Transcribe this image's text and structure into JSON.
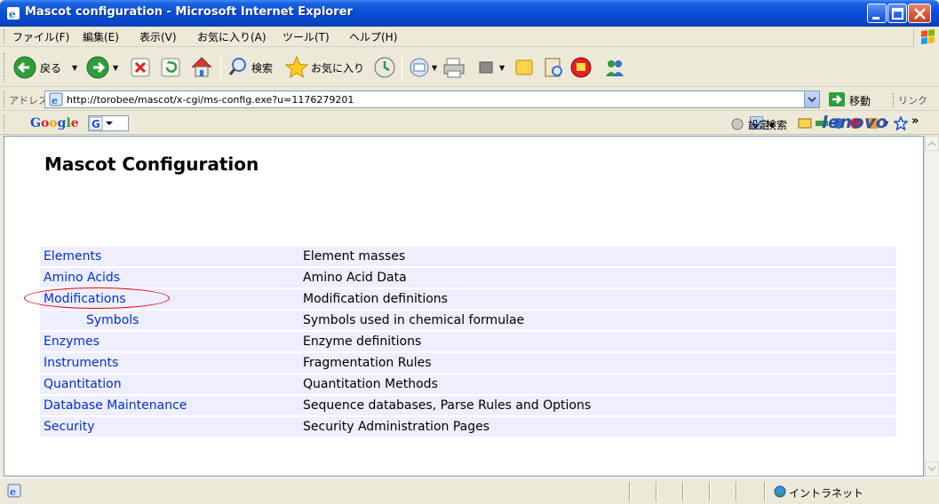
{
  "window": {
    "title": "Mascot configuration - Microsoft Internet Explorer"
  },
  "menu": {
    "items": [
      "ファイル(F)",
      "編集(E)",
      "表示(V)",
      "お気に入り(A)",
      "ツール(T)",
      "ヘルプ(H)"
    ]
  },
  "toolbar": {
    "back_label": "戻る",
    "search_label": "検索",
    "favorites_label": "お気に入り"
  },
  "address_bar": {
    "label": "アドレス(D)",
    "url": "http://torobee/mascot/x-cgi/ms-config.exe?u=1176279201",
    "go_label": "移動",
    "links_label": "リンク"
  },
  "google_bar": {
    "logo": "Google",
    "search_label": "検索",
    "settings_label": "設定▾",
    "brand": "lenovo"
  },
  "page": {
    "title": "Mascot Configuration",
    "rows": [
      {
        "link": "Elements",
        "description": "Element masses",
        "sub": false
      },
      {
        "link": "Amino Acids",
        "description": "Amino Acid Data",
        "sub": false
      },
      {
        "link": "Modifications",
        "description": "Modification definitions",
        "sub": false,
        "highlighted": true
      },
      {
        "link": "Symbols",
        "description": "Symbols used in chemical formulae",
        "sub": true
      },
      {
        "link": "Enzymes",
        "description": "Enzyme definitions",
        "sub": false
      },
      {
        "link": "Instruments",
        "description": "Fragmentation Rules",
        "sub": false
      },
      {
        "link": "Quantitation",
        "description": "Quantitation Methods",
        "sub": false
      },
      {
        "link": "Database Maintenance",
        "description": "Sequence databases, Parse Rules and Options",
        "sub": false
      },
      {
        "link": "Security",
        "description": "Security Administration Pages",
        "sub": false
      }
    ]
  },
  "status_bar": {
    "zone": "イントラネット"
  },
  "colors": {
    "link": "#0033cc",
    "row_background": "#eeeefe",
    "annotation_circle": "#e00000"
  }
}
